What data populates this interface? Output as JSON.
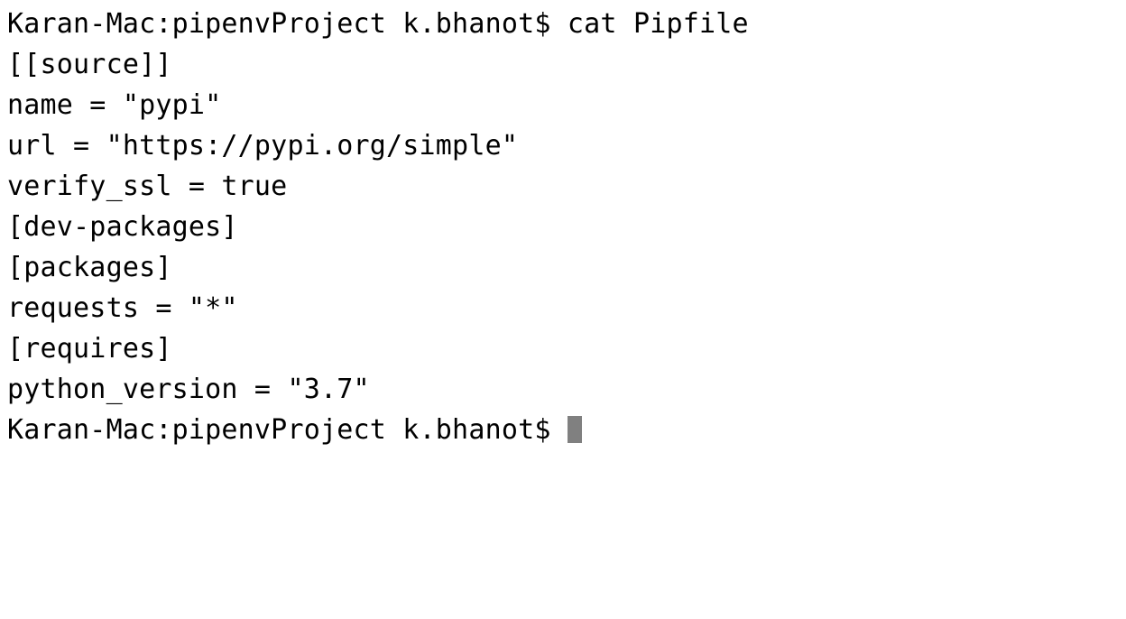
{
  "terminal": {
    "lines": {
      "l1_prompt": "Karan-Mac:pipenvProject k.bhanot$ ",
      "l1_cmd": "cat Pipfile",
      "l2": "[[source]]",
      "l3": "name = \"pypi\"",
      "l4": "url = \"https://pypi.org/simple\"",
      "l5": "verify_ssl = true",
      "l6": "",
      "l7": "[dev-packages]",
      "l8": "",
      "l9": "[packages]",
      "l10": "requests = \"*\"",
      "l11": "",
      "l12": "[requires]",
      "l13": "python_version = \"3.7\"",
      "l14_prompt": "Karan-Mac:pipenvProject k.bhanot$ "
    }
  }
}
